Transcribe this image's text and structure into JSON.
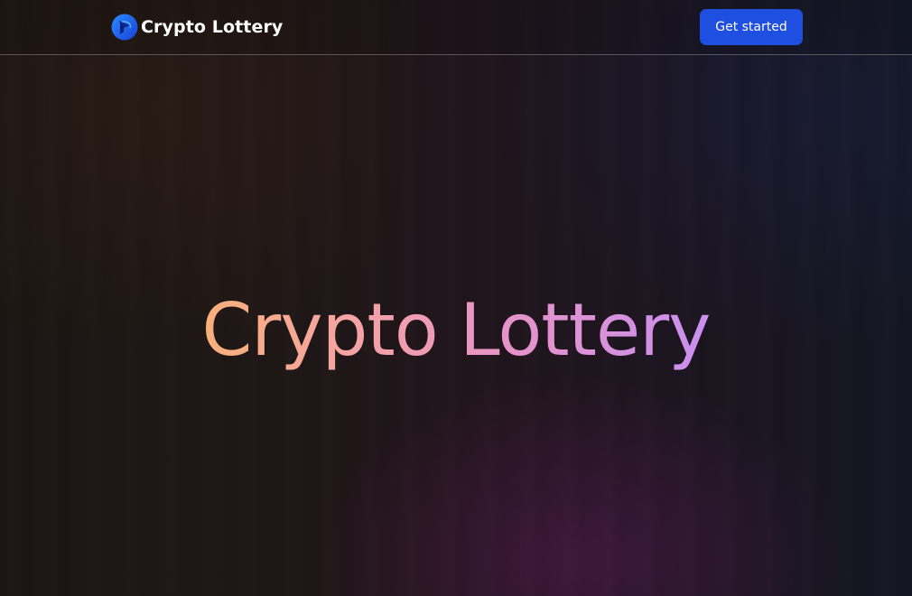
{
  "navbar": {
    "brand": {
      "logo_icon": "crypto-lottery-logo-icon",
      "name": "Crypto Lottery"
    },
    "cta_label": "Get started"
  },
  "hero": {
    "title": "Crypto Lottery"
  },
  "colors": {
    "cta_background": "#1f4fe0",
    "title_gradient_start": "#f8b07a",
    "title_gradient_end": "#c98ff0",
    "background": "#1b1613"
  }
}
